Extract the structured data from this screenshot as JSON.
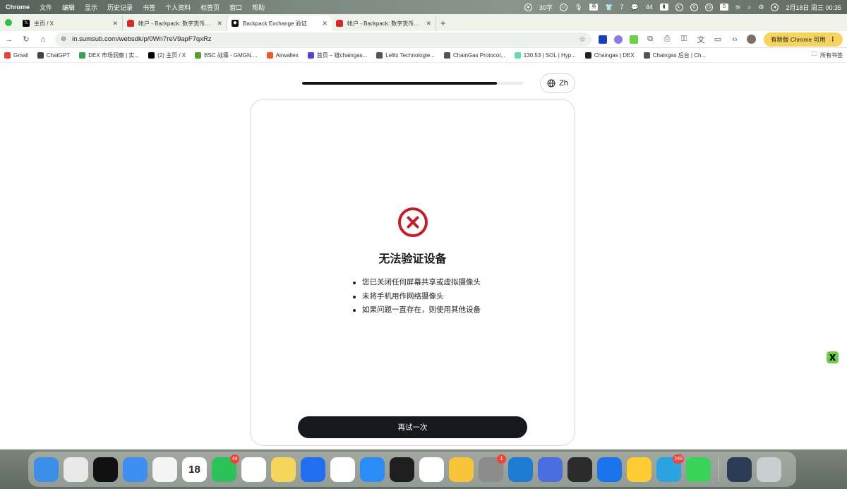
{
  "menubar": {
    "app": "Chrome",
    "menus": [
      "文件",
      "编辑",
      "显示",
      "历史记录",
      "书签",
      "个人资料",
      "标签页",
      "窗口",
      "帮助"
    ],
    "status": {
      "char_count": "30字",
      "wechat_count": "44",
      "num7": "7",
      "clock": "2月18日 周三  00:35"
    }
  },
  "tabs": [
    {
      "title": "主页 / X",
      "icon": "x-logo-icon"
    },
    {
      "title": "帐户 - Backpack: 数字货币交易",
      "icon": "lock-icon"
    },
    {
      "title": "Backpack Exchange 验证",
      "icon": "backpack-icon",
      "active": true
    },
    {
      "title": "帐户 - Backpack: 数字货币交易",
      "icon": "lock-icon"
    }
  ],
  "toolbar": {
    "url": "in.sumsub.com/websdk/p/0Wn7reV9apF7qxRz",
    "update_label": "有新版 Chrome 可用"
  },
  "bookmarks": [
    {
      "label": "Gmail",
      "color": "#e94235"
    },
    {
      "label": "ChatGPT",
      "color": "#444444"
    },
    {
      "label": "DEX 市场洞察 | 实...",
      "color": "#3aa34a"
    },
    {
      "label": "(2) 主页 / X",
      "color": "#000000"
    },
    {
      "label": "BSC 战壕 - GMGN....",
      "color": "#5a9d2f"
    },
    {
      "label": "Airwallex",
      "color": "#f05a28"
    },
    {
      "label": "首页 – 链chaingas...",
      "color": "#5b3fd1"
    },
    {
      "label": "Lellix Technologie...",
      "color": "#555555"
    },
    {
      "label": "ChainGas Protocol...",
      "color": "#555555"
    },
    {
      "label": "130.53 | SOL | Hyp...",
      "color": "#67d9b3"
    },
    {
      "label": "Chaingas | DEX",
      "color": "#222222"
    },
    {
      "label": "Chaingas 后台 | Ch...",
      "color": "#555555"
    }
  ],
  "bookmarks_all": "所有书签",
  "page": {
    "progress_percent": 88,
    "lang_label": "Zh",
    "title": "无法验证设备",
    "tips": [
      "您已关闭任何屏幕共享或虚拟摄像头",
      "未将手机用作网络摄像头",
      "如果问题一直存在，则使用其他设备"
    ],
    "retry_label": "再试一次",
    "error_color": "#c0202a"
  },
  "dock": [
    {
      "name": "finder-icon",
      "color": "#3b8fe6"
    },
    {
      "name": "launchpad-icon",
      "color": "#e9e9e9"
    },
    {
      "name": "tiktok-icon",
      "color": "#111111"
    },
    {
      "name": "safari-icon",
      "color": "#3d8ef0"
    },
    {
      "name": "photos-icon",
      "color": "#f4f4f4"
    },
    {
      "name": "calendar-icon",
      "color": "#ffffff",
      "text": "18"
    },
    {
      "name": "wechat-icon",
      "color": "#2dc15a",
      "badge": "44"
    },
    {
      "name": "reminders-icon",
      "color": "#ffffff"
    },
    {
      "name": "notes-icon",
      "color": "#f6d55c"
    },
    {
      "name": "mail-icon",
      "color": "#1f6ff0"
    },
    {
      "name": "chrome-icon",
      "color": "#ffffff"
    },
    {
      "name": "app-store-icon",
      "color": "#2a8cf7"
    },
    {
      "name": "terminal-icon",
      "color": "#1e1e1e"
    },
    {
      "name": "sheets-icon",
      "color": "#ffffff"
    },
    {
      "name": "m-app-icon",
      "color": "#f7c43a"
    },
    {
      "name": "system-settings-icon",
      "color": "#8c8c8c",
      "badge": "1"
    },
    {
      "name": "vscode-icon",
      "color": "#1f7bd1"
    },
    {
      "name": "phone-mirror-icon",
      "color": "#4a6ee0"
    },
    {
      "name": "cube-app-icon",
      "color": "#2b2b2b"
    },
    {
      "name": "windows-app-icon",
      "color": "#1a73e8"
    },
    {
      "name": "m-yellow-icon",
      "color": "#ffcc33"
    },
    {
      "name": "telegram-icon",
      "color": "#2aa3e0",
      "badge": "249"
    },
    {
      "name": "messages-icon",
      "color": "#39d35a"
    },
    {
      "name": "screen-preview-icon",
      "color": "#2b3a55"
    },
    {
      "name": "trash-icon",
      "color": "#c9cfd1"
    }
  ]
}
